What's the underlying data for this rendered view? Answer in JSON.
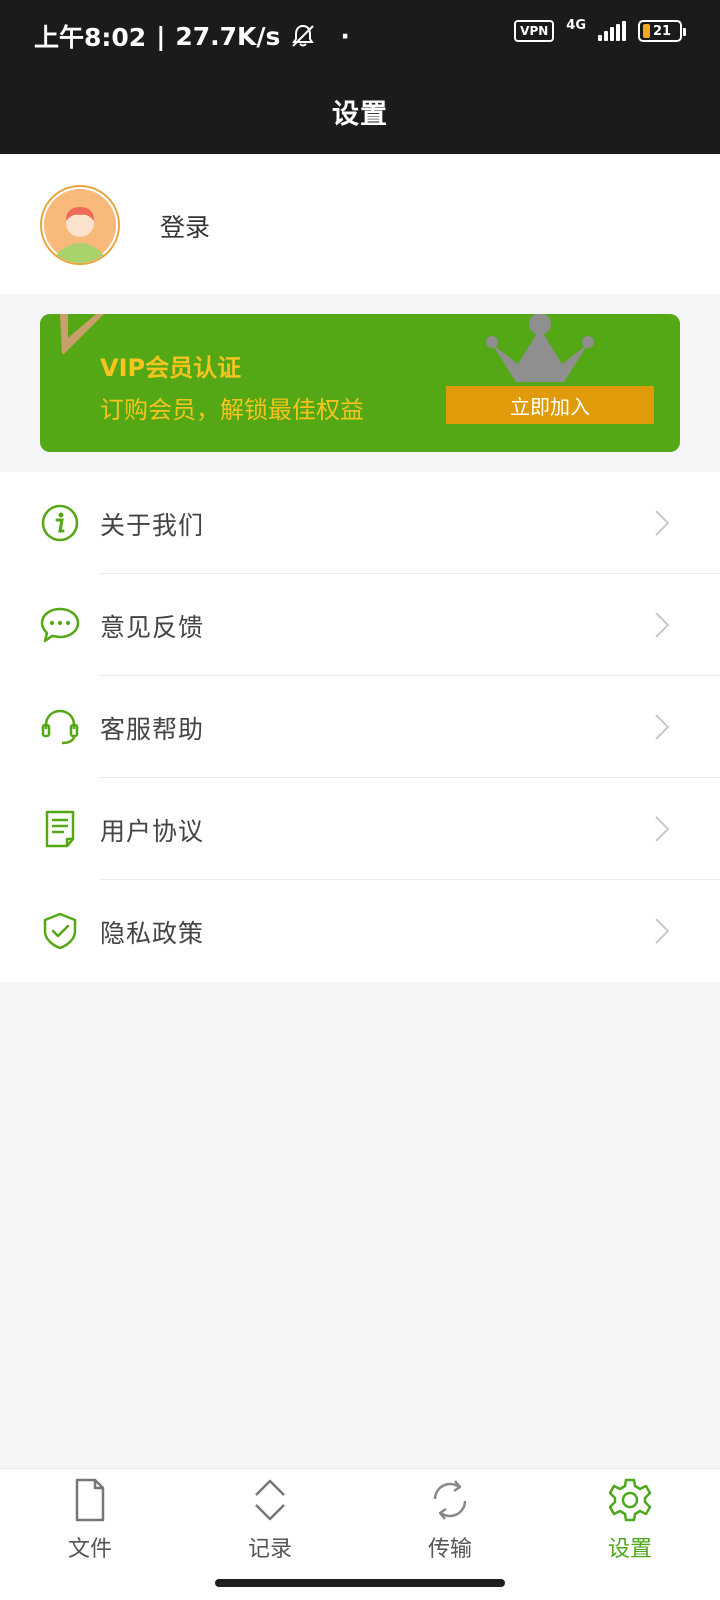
{
  "status_bar": {
    "time": "上午8:02",
    "separator": "|",
    "speed": "27.7K/s",
    "dot": "·",
    "vpn": "VPN",
    "network": "4G",
    "battery": "21",
    "icons": [
      "bell-muted-icon",
      "signal-icon",
      "battery-icon"
    ]
  },
  "header": {
    "title": "设置"
  },
  "profile": {
    "login_label": "登录",
    "avatar_icon": "avatar-icon"
  },
  "vip": {
    "title": "VIP会员认证",
    "subtitle": "订购会员，解锁最佳权益",
    "join_label": "立即加入",
    "colors": {
      "background": "#54a715",
      "text": "#f6c41f",
      "button": "#df9b0a"
    }
  },
  "menu": {
    "items": [
      {
        "label": "关于我们",
        "icon": "info-icon"
      },
      {
        "label": "意见反馈",
        "icon": "chat-bubble-icon"
      },
      {
        "label": "客服帮助",
        "icon": "headset-icon"
      },
      {
        "label": "用户协议",
        "icon": "document-icon"
      },
      {
        "label": "隐私政策",
        "icon": "shield-check-icon"
      }
    ]
  },
  "bottom_nav": {
    "tabs": [
      {
        "label": "文件",
        "icon": "file-icon",
        "active": false
      },
      {
        "label": "记录",
        "icon": "chevron-updown-icon",
        "active": false
      },
      {
        "label": "传输",
        "icon": "sync-icon",
        "active": false
      },
      {
        "label": "设置",
        "icon": "gear-icon",
        "active": true
      }
    ],
    "colors": {
      "active": "#4fa81a",
      "inactive": "#555555"
    }
  }
}
